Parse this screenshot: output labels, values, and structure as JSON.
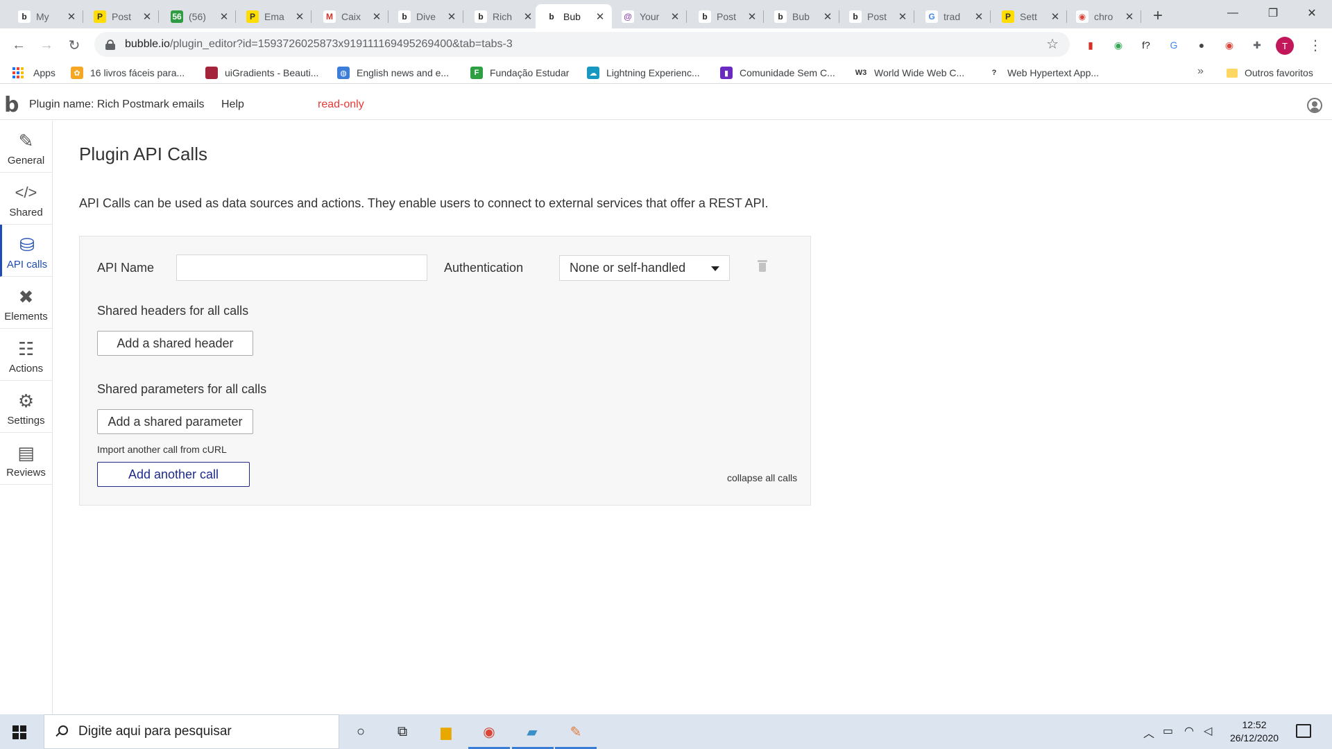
{
  "browser": {
    "tabs": [
      {
        "title": "My",
        "favicon": "b",
        "fav_bg": "#ffffff",
        "fav_color": "#222222"
      },
      {
        "title": "Post",
        "favicon": "P",
        "fav_bg": "#ffdd00",
        "fav_color": "#333333"
      },
      {
        "title": "(56)",
        "favicon": "56",
        "fav_bg": "#2e9c42",
        "fav_color": "#ffffff"
      },
      {
        "title": "Ema",
        "favicon": "P",
        "fav_bg": "#ffdd00",
        "fav_color": "#333333"
      },
      {
        "title": "Caix",
        "favicon": "M",
        "fav_bg": "#ffffff",
        "fav_color": "#d93025"
      },
      {
        "title": "Dive",
        "favicon": "b",
        "fav_bg": "#ffffff",
        "fav_color": "#222222"
      },
      {
        "title": "Rich",
        "favicon": "b",
        "fav_bg": "#ffffff",
        "fav_color": "#222222"
      },
      {
        "title": "Bub",
        "favicon": "b",
        "fav_bg": "#ffffff",
        "fav_color": "#222222"
      },
      {
        "title": "Your",
        "favicon": "@",
        "fav_bg": "#ffffff",
        "fav_color": "#8e44ad"
      },
      {
        "title": "Post",
        "favicon": "b",
        "fav_bg": "#ffffff",
        "fav_color": "#222222"
      },
      {
        "title": "Bub",
        "favicon": "b",
        "fav_bg": "#ffffff",
        "fav_color": "#222222"
      },
      {
        "title": "Post",
        "favicon": "b",
        "fav_bg": "#ffffff",
        "fav_color": "#222222"
      },
      {
        "title": "trad",
        "favicon": "G",
        "fav_bg": "#ffffff",
        "fav_color": "#4285f4"
      },
      {
        "title": "Sett",
        "favicon": "P",
        "fav_bg": "#ffdd00",
        "fav_color": "#333333"
      },
      {
        "title": "chro",
        "favicon": "◉",
        "fav_bg": "#ffffff",
        "fav_color": "#db4437"
      }
    ],
    "active_tab_index": 7,
    "close_glyph": "✕",
    "new_tab_glyph": "+",
    "window_controls": {
      "minimize": "—",
      "maximize": "❐",
      "close": "✕"
    },
    "nav": {
      "back": "←",
      "forward": "→",
      "reload": "↻"
    },
    "url_host": "bubble.io",
    "url_path": "/plugin_editor?id=1593726025873x919111169495269400&tab=tabs-3",
    "star_glyph": "☆",
    "profile_initial": "T",
    "menu_glyph": "⋮",
    "extensions": [
      {
        "name": "bookmark-ext-icon",
        "glyph": "▮",
        "color": "#d93025"
      },
      {
        "name": "color-picker-ext-icon",
        "glyph": "◉",
        "color": "#34a853"
      },
      {
        "name": "font-ext-icon",
        "glyph": "f?",
        "color": "#222222"
      },
      {
        "name": "translate-ext-icon",
        "glyph": "G",
        "color": "#4285f4"
      },
      {
        "name": "dark-ext-icon",
        "glyph": "●",
        "color": "#444444"
      },
      {
        "name": "chrome-ext-icon",
        "glyph": "◉",
        "color": "#db4437"
      },
      {
        "name": "puzzle-ext-icon",
        "glyph": "✚",
        "color": "#5f6368"
      }
    ],
    "bookmarks": [
      {
        "label": "Apps",
        "icon": "apps-grid"
      },
      {
        "label": "16 livros fáceis para...",
        "icon_bg": "#f5a623",
        "glyph": "✿"
      },
      {
        "label": "uiGradients - Beauti...",
        "icon_bg": "#a3243b",
        "glyph": ""
      },
      {
        "label": "English news and e...",
        "icon_bg": "#3b7dd8",
        "glyph": "◍"
      },
      {
        "label": "Fundação Estudar",
        "icon_bg": "#2ea043",
        "glyph": "F"
      },
      {
        "label": "Lightning Experienc...",
        "icon_bg": "#1798c1",
        "glyph": "☁"
      },
      {
        "label": "Comunidade Sem C...",
        "icon_bg": "#6a2ac0",
        "glyph": "▮"
      },
      {
        "label": "World Wide Web C...",
        "icon_bg": "#ffffff",
        "glyph": "W3"
      },
      {
        "label": "Web Hypertext App...",
        "icon_bg": "#ffffff",
        "glyph": "?"
      }
    ],
    "bookmarks_more": "»",
    "other_bookmarks": "Outros favoritos"
  },
  "editor": {
    "logo": "b",
    "plugin_name": "Plugin name: Rich Postmark emails",
    "help": "Help",
    "mode": "read-only",
    "sidebar": [
      {
        "label": "General",
        "icon": "brush-icon",
        "glyph": "✎"
      },
      {
        "label": "Shared",
        "icon": "code-icon",
        "glyph": "</>"
      },
      {
        "label": "API calls",
        "icon": "plug-icon",
        "glyph": "⛁"
      },
      {
        "label": "Elements",
        "icon": "tools-icon",
        "glyph": "✖"
      },
      {
        "label": "Actions",
        "icon": "workflow-icon",
        "glyph": "☷"
      },
      {
        "label": "Settings",
        "icon": "gear-icon",
        "glyph": "⚙"
      },
      {
        "label": "Reviews",
        "icon": "document-icon",
        "glyph": "▤"
      }
    ],
    "active_sidebar": 2,
    "page_title": "Plugin API Calls",
    "page_description": "API Calls can be used as data sources and actions. They enable users to connect to external services that offer a REST API.",
    "panel": {
      "api_name_label": "API Name",
      "api_name_value": "",
      "auth_label": "Authentication",
      "auth_value": "None or self-handled",
      "shared_headers_label": "Shared headers for all calls",
      "add_header_button": "Add a shared header",
      "shared_params_label": "Shared parameters for all calls",
      "add_param_button": "Add a shared parameter",
      "import_curl_link": "Import another call from cURL",
      "add_call_button": "Add another call",
      "collapse_link": "collapse all calls"
    }
  },
  "taskbar": {
    "search_placeholder": "Digite aqui para pesquisar",
    "time": "12:52",
    "date": "26/12/2020"
  }
}
